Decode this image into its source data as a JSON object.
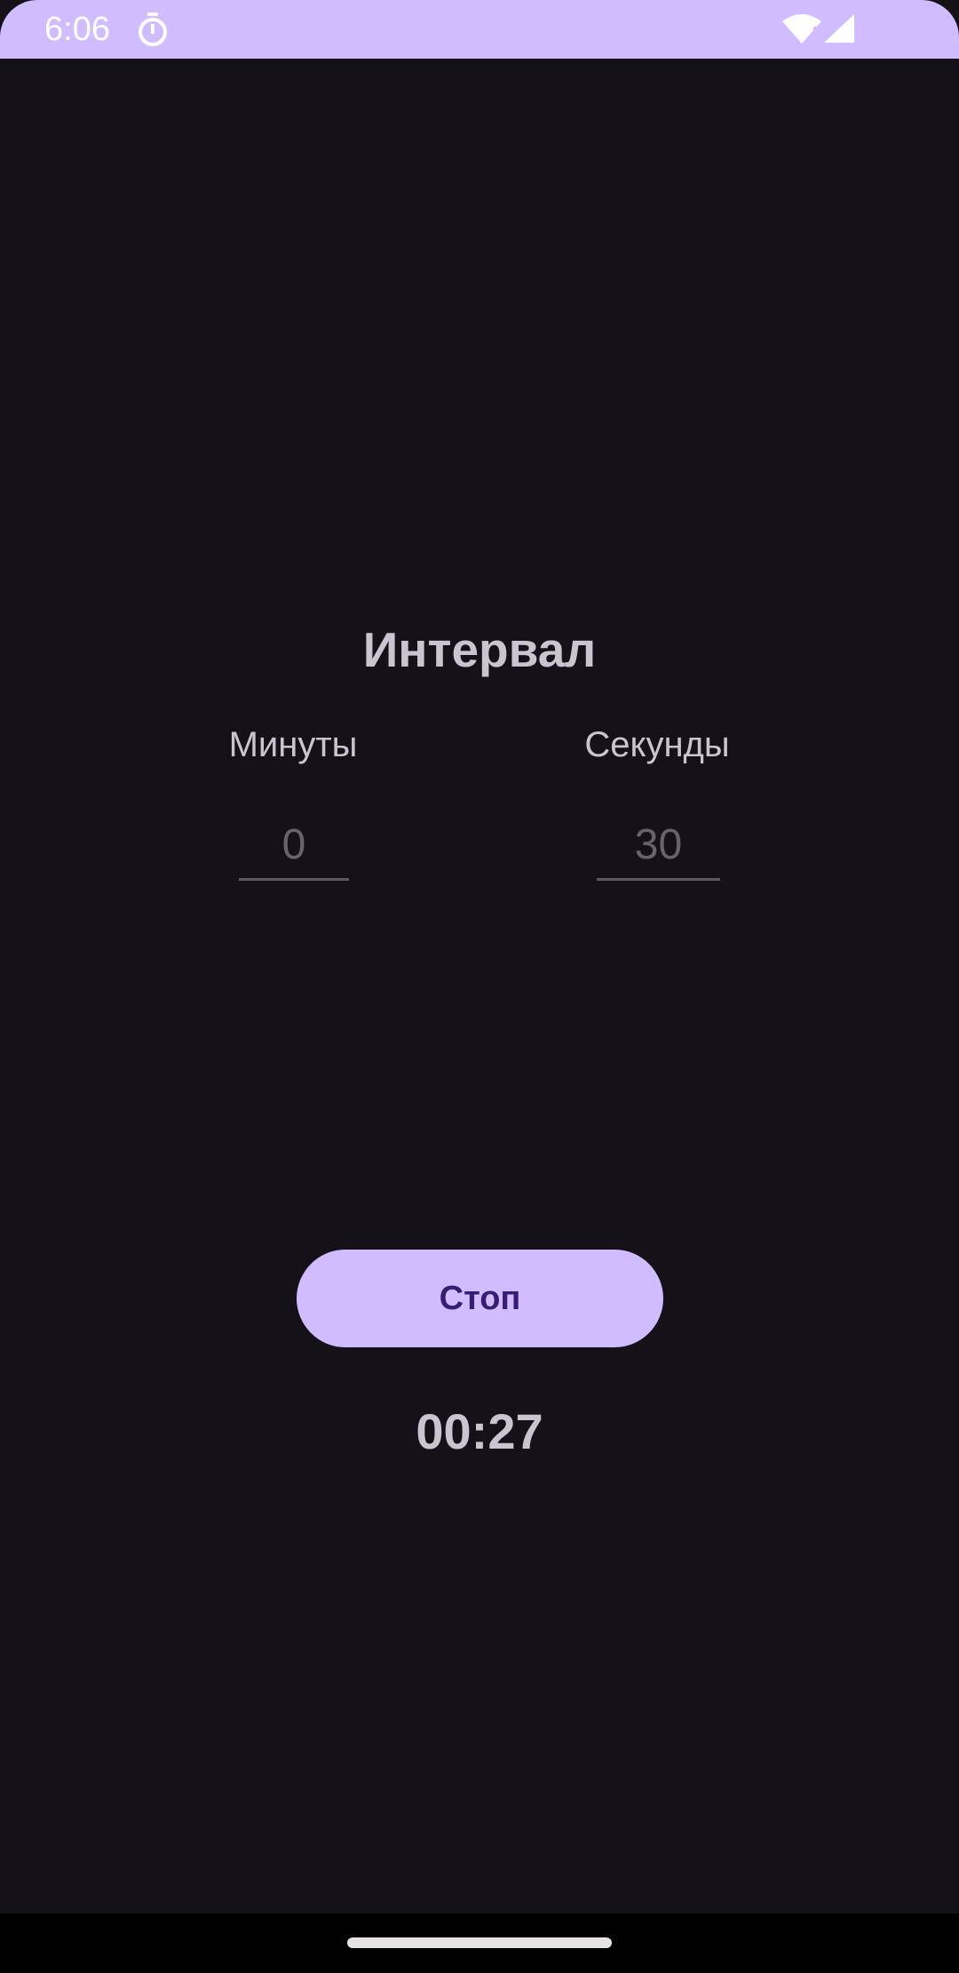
{
  "status_bar": {
    "time": "6:06",
    "icons": [
      "stopwatch-icon",
      "wifi-icon",
      "signal-icon"
    ],
    "background_color": "#d0bcff"
  },
  "interval": {
    "title": "Интервал",
    "minutes_label": "Минуты",
    "seconds_label": "Секунды",
    "minutes_placeholder": "0",
    "seconds_placeholder": "30"
  },
  "controls": {
    "stop_label": "Стоп",
    "button_color": "#d0bcff",
    "button_text_color": "#381e72"
  },
  "timer": {
    "display": "00:27"
  },
  "theme": {
    "background": "#141218",
    "text": "#cac4d0"
  }
}
